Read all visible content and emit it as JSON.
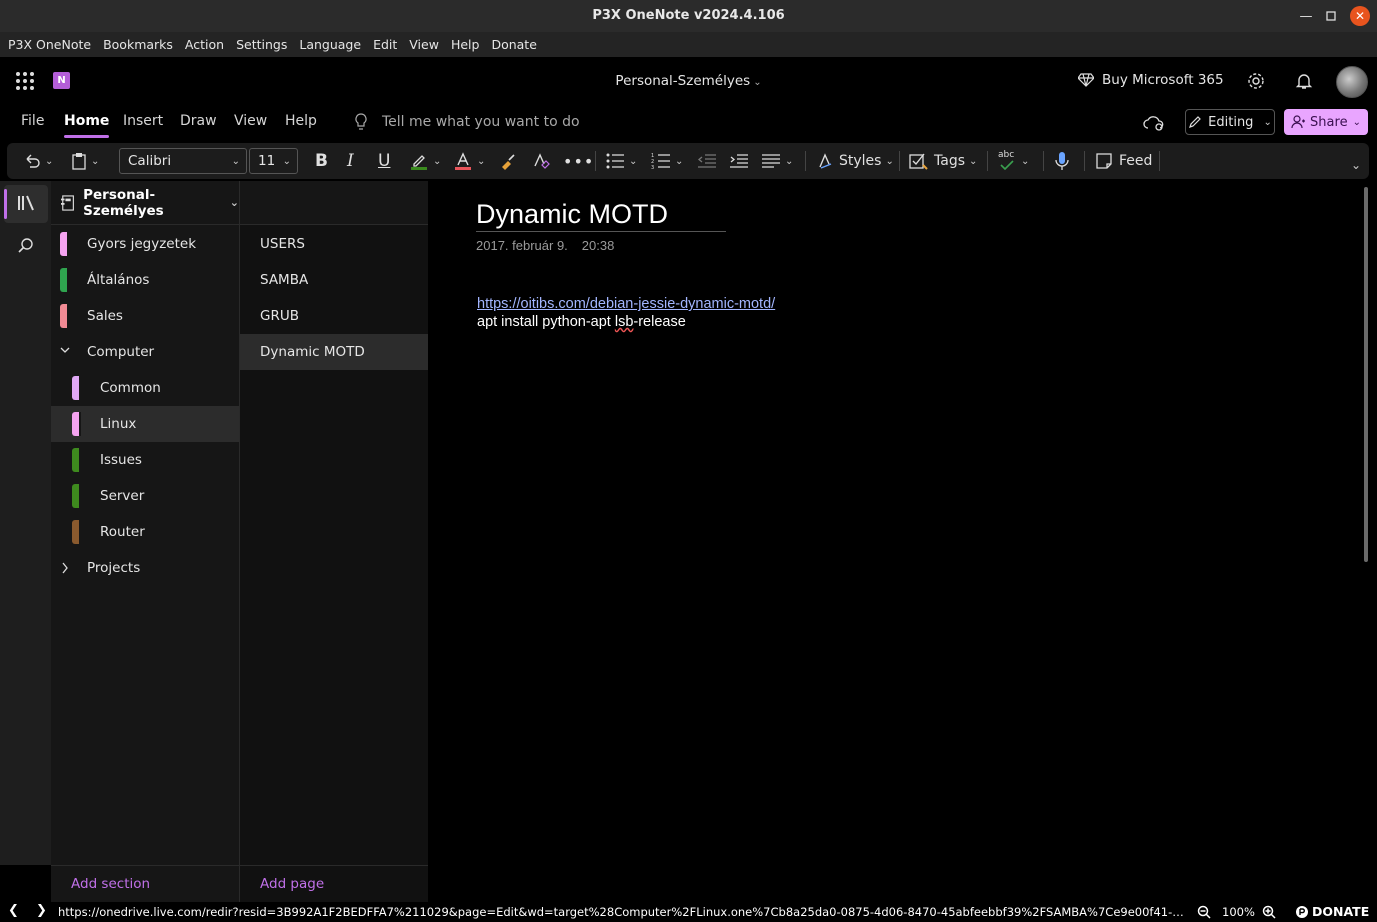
{
  "window": {
    "title": "P3X OneNote v2024.4.106"
  },
  "menubar": [
    "P3X OneNote",
    "Bookmarks",
    "Action",
    "Settings",
    "Language",
    "Edit",
    "View",
    "Help",
    "Donate"
  ],
  "header": {
    "notebook_title": "Personal-Személyes",
    "buy_label": "Buy Microsoft 365"
  },
  "tabs": [
    {
      "label": "File"
    },
    {
      "label": "Home",
      "active": true
    },
    {
      "label": "Insert"
    },
    {
      "label": "Draw"
    },
    {
      "label": "View"
    },
    {
      "label": "Help"
    }
  ],
  "tellme_placeholder": "Tell me what you want to do",
  "editing_label": "Editing",
  "share_label": "Share",
  "ribbon": {
    "font_name": "Calibri",
    "font_size": "11",
    "styles_label": "Styles",
    "tags_label": "Tags",
    "feed_label": "Feed",
    "spell_label": "abc"
  },
  "notebook": {
    "name": "Personal-Személyes"
  },
  "sections": [
    {
      "label": "Gyors jegyzetek",
      "color": "#f5a3f0",
      "indent": 0
    },
    {
      "label": "Általános",
      "color": "#2fa44f",
      "indent": 0
    },
    {
      "label": "Sales",
      "color": "#f28b95",
      "indent": 0
    },
    {
      "label": "Computer",
      "group": true,
      "expanded": true,
      "indent": 0
    },
    {
      "label": "Common",
      "color": "#e0a8f5",
      "indent": 1
    },
    {
      "label": "Linux",
      "color": "#f5a3f0",
      "indent": 1,
      "selected": true
    },
    {
      "label": "Issues",
      "color": "#3e8a1e",
      "indent": 1
    },
    {
      "label": "Server",
      "color": "#3e8a1e",
      "indent": 1
    },
    {
      "label": "Router",
      "color": "#8a5a2e",
      "indent": 1
    },
    {
      "label": "Projects",
      "group": true,
      "expanded": false,
      "indent": 0
    }
  ],
  "pages": [
    {
      "label": "USERS"
    },
    {
      "label": "SAMBA"
    },
    {
      "label": "GRUB"
    },
    {
      "label": "Dynamic MOTD",
      "selected": true
    }
  ],
  "add_section_label": "Add section",
  "add_page_label": "Add page",
  "page": {
    "title": "Dynamic MOTD",
    "date": "2017. február 9.",
    "time": "20:38",
    "link": "https://oitibs.com/debian-jessie-dynamic-motd/",
    "text_before": "apt install python-apt ",
    "text_misspelled": "lsb",
    "text_after": "-release"
  },
  "statusbar": {
    "url": "https://onedrive.live.com/redir?resid=3B992A1F2BEDFFA7%211029&page=Edit&wd=target%28Computer%2FLinux.one%7Cb8a25da0-0875-4d06-8470-45abfeebbf39%2FSAMBA%7Ce9e00f41-3df6-4d3d-be53-99...",
    "zoom": "100%",
    "donate": "DONATE"
  },
  "colors": {
    "accent": "#c070e8",
    "share_bg": "#e9a5ff"
  }
}
